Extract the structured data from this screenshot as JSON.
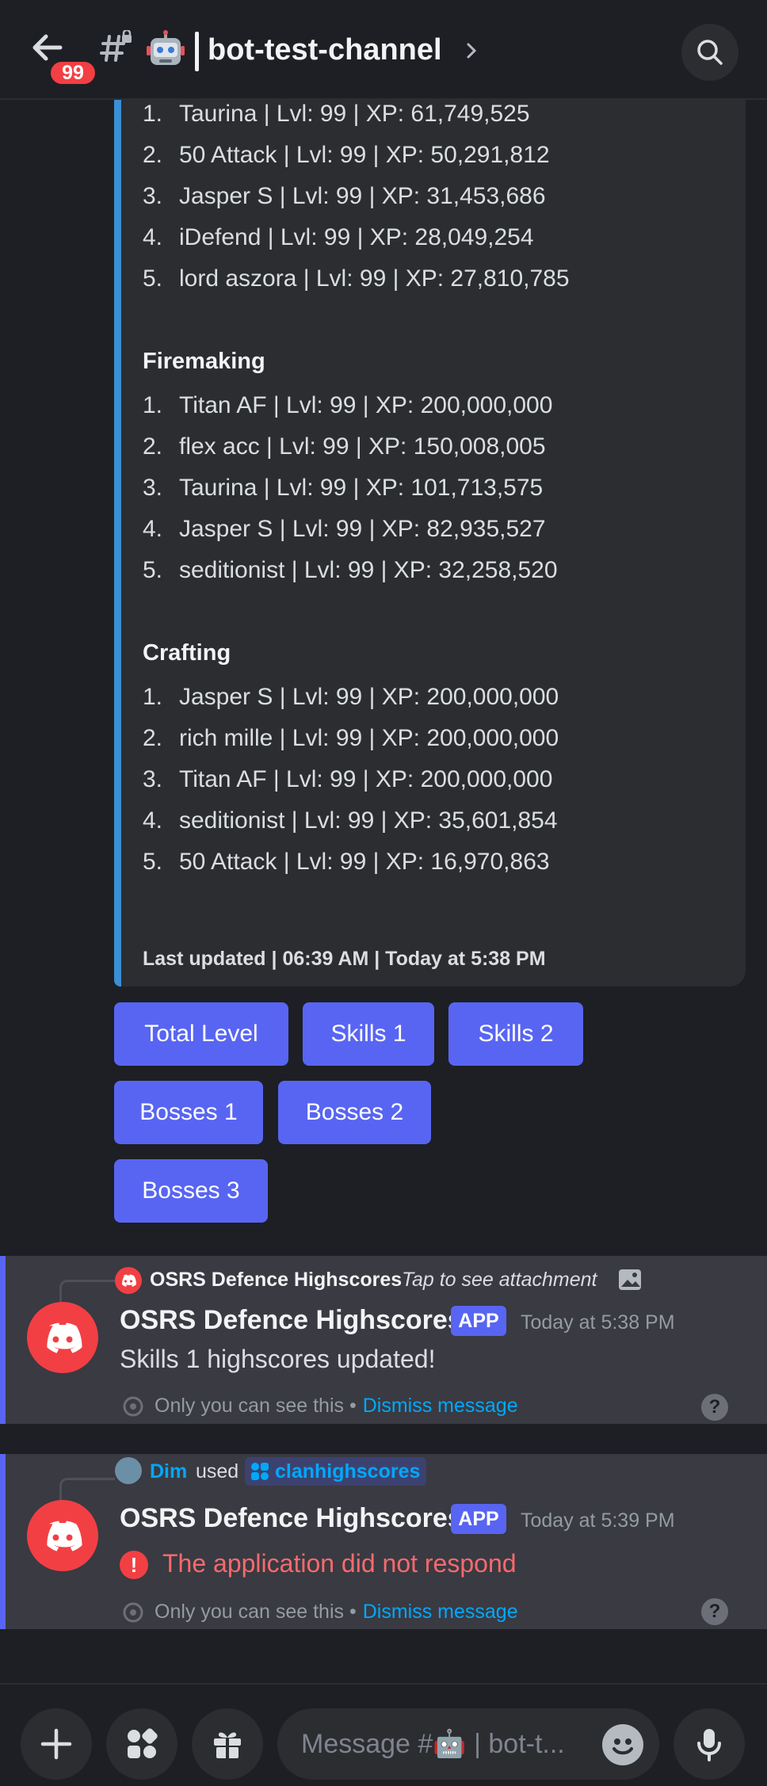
{
  "header": {
    "badge_count": "99",
    "channel_name": "bot-test-channel",
    "icons": [
      "back-arrow-icon",
      "hash-lock-icon",
      "robot-emoji-icon",
      "chevron-right-icon",
      "search-icon"
    ]
  },
  "embed": {
    "top_list": [
      {
        "num": "1.",
        "text": "Taurina | Lvl: 99 | XP: 61,749,525"
      },
      {
        "num": "2.",
        "text": "50 Attack | Lvl: 99 | XP: 50,291,812"
      },
      {
        "num": "3.",
        "text": "Jasper S | Lvl: 99 | XP: 31,453,686"
      },
      {
        "num": "4.",
        "text": "iDefend | Lvl: 99 | XP: 28,049,254"
      },
      {
        "num": "5.",
        "text": "lord aszora | Lvl: 99 | XP: 27,810,785"
      }
    ],
    "firemaking_title": "Firemaking",
    "firemaking": [
      {
        "num": "1.",
        "text": "Titan AF | Lvl: 99 | XP: 200,000,000"
      },
      {
        "num": "2.",
        "text": "flex acc | Lvl: 99 | XP: 150,008,005"
      },
      {
        "num": "3.",
        "text": "Taurina | Lvl: 99 | XP: 101,713,575"
      },
      {
        "num": "4.",
        "text": "Jasper S | Lvl: 99 | XP: 82,935,527"
      },
      {
        "num": "5.",
        "text": "seditionist | Lvl: 99 | XP: 32,258,520"
      }
    ],
    "crafting_title": "Crafting",
    "crafting": [
      {
        "num": "1.",
        "text": "Jasper S | Lvl: 99 | XP: 200,000,000"
      },
      {
        "num": "2.",
        "text": "rich mille | Lvl: 99 | XP: 200,000,000"
      },
      {
        "num": "3.",
        "text": "Titan AF | Lvl: 99 | XP: 200,000,000"
      },
      {
        "num": "4.",
        "text": "seditionist | Lvl: 99 | XP: 35,601,854"
      },
      {
        "num": "5.",
        "text": "50 Attack | Lvl: 99 | XP: 16,970,863"
      }
    ],
    "footer": "Last updated | 06:39 AM | Today at 5:38 PM",
    "accent_color": "#3a8fd6"
  },
  "buttons": {
    "total_level": "Total Level",
    "skills_1": "Skills 1",
    "skills_2": "Skills 2",
    "bosses_1": "Bosses 1",
    "bosses_2": "Bosses 2",
    "bosses_3": "Bosses 3"
  },
  "message1": {
    "reply_author": "OSRS Defence Highscores",
    "reply_text": "Tap to see attachment",
    "author": "OSRS Defence Highscores",
    "app_tag": "APP",
    "timestamp": "Today at 5:38 PM",
    "content": "Skills 1 highscores updated!",
    "ephemeral_note": "Only you can see this •",
    "dismiss": "Dismiss message",
    "help": "?"
  },
  "message2": {
    "reply_user": "Dim",
    "reply_used": "used",
    "command": "clanhighscores",
    "author": "OSRS Defence Highscores",
    "app_tag": "APP",
    "timestamp": "Today at 5:39 PM",
    "error": "The application did not respond",
    "ephemeral_note": "Only you can see this •",
    "dismiss": "Dismiss message",
    "help": "?"
  },
  "composer": {
    "placeholder": "Message #🤖 | bot-t..."
  },
  "colors": {
    "blurple": "#5865f2",
    "danger": "#f23f43",
    "link": "#00a8fc"
  }
}
